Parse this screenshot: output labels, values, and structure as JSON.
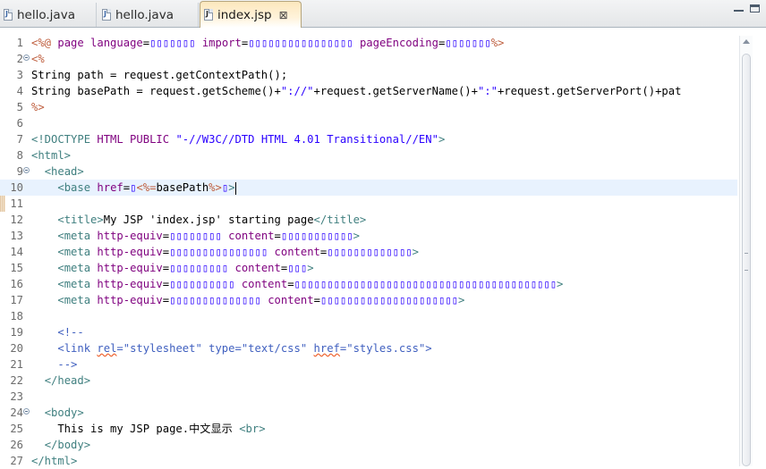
{
  "tabs": [
    {
      "label": "hello.java",
      "icon": "java-file-icon",
      "active": false
    },
    {
      "label": "hello.java",
      "icon": "java-file-icon",
      "active": false
    },
    {
      "label": "index.jsp",
      "icon": "jsp-file-icon",
      "active": true,
      "close_glyph": "⊠"
    }
  ],
  "window": {
    "minimize_icon": "minimize-icon",
    "maximize_icon": "maximize-icon"
  },
  "editor": {
    "current_line": 10,
    "lines": [
      {
        "n": "1",
        "tokens": [
          [
            "dir",
            "<%@ "
          ],
          [
            "attr",
            "page "
          ],
          [
            "attr",
            "language"
          ],
          [
            "txt",
            "="
          ],
          [
            "str",
            "▯▯▯▯▯▯▯"
          ],
          [
            "txt",
            " "
          ],
          [
            "attr",
            "import"
          ],
          [
            "txt",
            "="
          ],
          [
            "str",
            "▯▯▯▯▯▯▯▯▯▯▯▯▯▯▯▯"
          ],
          [
            "txt",
            " "
          ],
          [
            "attr",
            "pageEncoding"
          ],
          [
            "txt",
            "="
          ],
          [
            "str",
            "▯▯▯▯▯▯▯"
          ],
          [
            "dir",
            "%>"
          ]
        ]
      },
      {
        "n": "2",
        "fold": true,
        "tokens": [
          [
            "dir",
            "<%"
          ]
        ]
      },
      {
        "n": "3",
        "tokens": [
          [
            "txt",
            "String path = request.getContextPath();"
          ]
        ]
      },
      {
        "n": "4",
        "tokens": [
          [
            "txt",
            "String basePath = request.getScheme()+"
          ],
          [
            "str",
            "\"://\""
          ],
          [
            "txt",
            "+request.getServerName()+"
          ],
          [
            "str",
            "\":\""
          ],
          [
            "txt",
            "+request.getServerPort()+pat"
          ]
        ]
      },
      {
        "n": "5",
        "tokens": [
          [
            "dir",
            "%>"
          ]
        ]
      },
      {
        "n": "6",
        "tokens": []
      },
      {
        "n": "7",
        "tokens": [
          [
            "doc",
            "<!DOCTYPE "
          ],
          [
            "attr",
            "HTML PUBLIC "
          ],
          [
            "str",
            "\"-//W3C//DTD HTML 4.01 Transitional//EN\""
          ],
          [
            "doc",
            ">"
          ]
        ]
      },
      {
        "n": "8",
        "tokens": [
          [
            "tag",
            "<html>"
          ]
        ]
      },
      {
        "n": "9",
        "fold": true,
        "tokens": [
          [
            "txt",
            "  "
          ],
          [
            "tag",
            "<head>"
          ]
        ]
      },
      {
        "n": "10",
        "tokens": [
          [
            "txt",
            "    "
          ],
          [
            "tag",
            "<base "
          ],
          [
            "attr",
            "href"
          ],
          [
            "txt",
            "="
          ],
          [
            "str",
            "▯"
          ],
          [
            "dir",
            "<%="
          ],
          [
            "txt",
            "basePath"
          ],
          [
            "dir",
            "%>"
          ],
          [
            "str",
            "▯"
          ],
          [
            "tag",
            ">"
          ]
        ],
        "caret": true
      },
      {
        "n": "11",
        "tokens": []
      },
      {
        "n": "12",
        "tokens": [
          [
            "txt",
            "    "
          ],
          [
            "tag",
            "<title>"
          ],
          [
            "txt",
            "My JSP 'index.jsp' starting page"
          ],
          [
            "tag",
            "</title>"
          ]
        ]
      },
      {
        "n": "13",
        "tokens": [
          [
            "txt",
            "    "
          ],
          [
            "tag",
            "<meta "
          ],
          [
            "attr",
            "http-equiv"
          ],
          [
            "txt",
            "="
          ],
          [
            "str",
            "▯▯▯▯▯▯▯▯"
          ],
          [
            "txt",
            " "
          ],
          [
            "attr",
            "content"
          ],
          [
            "txt",
            "="
          ],
          [
            "str",
            "▯▯▯▯▯▯▯▯▯▯▯"
          ],
          [
            "tag",
            ">"
          ]
        ]
      },
      {
        "n": "14",
        "tokens": [
          [
            "txt",
            "    "
          ],
          [
            "tag",
            "<meta "
          ],
          [
            "attr",
            "http-equiv"
          ],
          [
            "txt",
            "="
          ],
          [
            "str",
            "▯▯▯▯▯▯▯▯▯▯▯▯▯▯▯"
          ],
          [
            "txt",
            " "
          ],
          [
            "attr",
            "content"
          ],
          [
            "txt",
            "="
          ],
          [
            "str",
            "▯▯▯▯▯▯▯▯▯▯▯▯▯"
          ],
          [
            "tag",
            ">"
          ]
        ]
      },
      {
        "n": "15",
        "tokens": [
          [
            "txt",
            "    "
          ],
          [
            "tag",
            "<meta "
          ],
          [
            "attr",
            "http-equiv"
          ],
          [
            "txt",
            "="
          ],
          [
            "str",
            "▯▯▯▯▯▯▯▯▯"
          ],
          [
            "txt",
            " "
          ],
          [
            "attr",
            "content"
          ],
          [
            "txt",
            "="
          ],
          [
            "str",
            "▯▯▯"
          ],
          [
            "tag",
            ">"
          ]
        ]
      },
      {
        "n": "16",
        "tokens": [
          [
            "txt",
            "    "
          ],
          [
            "tag",
            "<meta "
          ],
          [
            "attr",
            "http-equiv"
          ],
          [
            "txt",
            "="
          ],
          [
            "str",
            "▯▯▯▯▯▯▯▯▯▯"
          ],
          [
            "txt",
            " "
          ],
          [
            "attr",
            "content"
          ],
          [
            "txt",
            "="
          ],
          [
            "str",
            "▯▯▯▯▯▯▯▯▯▯▯▯▯▯▯▯▯▯▯▯▯▯▯▯▯▯▯▯▯▯▯▯▯▯▯▯▯▯▯▯"
          ],
          [
            "tag",
            ">"
          ]
        ]
      },
      {
        "n": "17",
        "tokens": [
          [
            "txt",
            "    "
          ],
          [
            "tag",
            "<meta "
          ],
          [
            "attr",
            "http-equiv"
          ],
          [
            "txt",
            "="
          ],
          [
            "str",
            "▯▯▯▯▯▯▯▯▯▯▯▯▯▯"
          ],
          [
            "txt",
            " "
          ],
          [
            "attr",
            "content"
          ],
          [
            "txt",
            "="
          ],
          [
            "str",
            "▯▯▯▯▯▯▯▯▯▯▯▯▯▯▯▯▯▯▯▯▯"
          ],
          [
            "tag",
            ">"
          ]
        ]
      },
      {
        "n": "18",
        "tokens": []
      },
      {
        "n": "19",
        "tokens": [
          [
            "txt",
            "    "
          ],
          [
            "com",
            "<!--"
          ]
        ]
      },
      {
        "n": "20",
        "tokens": [
          [
            "txt",
            "    "
          ],
          [
            "com",
            "<link "
          ],
          [
            "sq",
            "rel"
          ],
          [
            "com",
            "=\"stylesheet\" type=\"text/css\" "
          ],
          [
            "sq",
            "href"
          ],
          [
            "com",
            "=\"styles.css\">"
          ]
        ]
      },
      {
        "n": "21",
        "tokens": [
          [
            "txt",
            "    "
          ],
          [
            "com",
            "-->"
          ]
        ]
      },
      {
        "n": "22",
        "tokens": [
          [
            "txt",
            "  "
          ],
          [
            "tag",
            "</head>"
          ]
        ]
      },
      {
        "n": "23",
        "tokens": []
      },
      {
        "n": "24",
        "fold": true,
        "tokens": [
          [
            "txt",
            "  "
          ],
          [
            "tag",
            "<body>"
          ]
        ]
      },
      {
        "n": "25",
        "tokens": [
          [
            "txt",
            "    This is my JSP page.中文显示 "
          ],
          [
            "tag",
            "<br>"
          ]
        ]
      },
      {
        "n": "26",
        "tokens": [
          [
            "txt",
            "  "
          ],
          [
            "tag",
            "</body>"
          ]
        ]
      },
      {
        "n": "27",
        "tokens": [
          [
            "tag",
            "</html>"
          ]
        ]
      }
    ]
  }
}
